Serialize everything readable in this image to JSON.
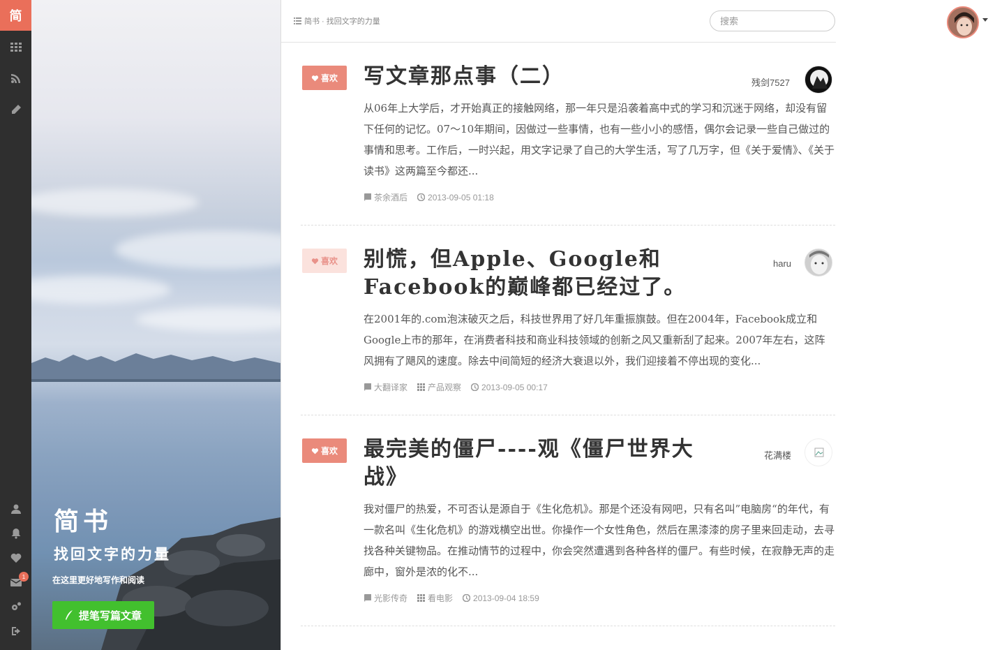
{
  "rail": {
    "logo": "简",
    "top_items": [
      "grid-icon",
      "rss-icon",
      "pencil-icon"
    ],
    "bottom_items": [
      "user-icon",
      "bell-icon",
      "heart-icon",
      "mail-icon",
      "settings-icon",
      "logout-icon"
    ],
    "mail_badge": "1"
  },
  "cover": {
    "title": "简书",
    "slogan": "找回文字的力量",
    "subtitle": "在这里更好地写作和阅读",
    "write_button": "提笔写篇文章"
  },
  "header": {
    "breadcrumb": "简书 · 找回文字的力量",
    "search_placeholder": "搜索"
  },
  "articles": [
    {
      "like_label": "喜欢",
      "title": "写文章那点事（二）",
      "author": "残剑7527",
      "body": "从06年上大学后，才开始真正的接触网络，那一年只是沿袭着高中式的学习和沉迷于网络，却没有留下任何的记忆。07～10年期间，因做过一些事情，也有一些小小的感悟，偶尔会记录一些自己做过的事情和思考。工作后，一时兴起，用文字记录了自己的大学生活，写了几万字，但《关于爱情》、《关于读书》这两篇至今都还...",
      "notebook": "茶余酒后",
      "collection": "",
      "time": "2013-09-05 01:18"
    },
    {
      "like_label": "喜欢",
      "title": "别慌，但Apple、Google和Facebook的巅峰都已经过了。",
      "author": "haru",
      "body": "在2001年的.com泡沫破灭之后，科技世界用了好几年重振旗鼓。但在2004年，Facebook成立和Google上市的那年，在消费者科技和商业科技领域的创新之风又重新刮了起来。2007年左右，这阵风拥有了飓风的速度。除去中间简短的经济大衰退以外，我们迎接着不停出现的变化...",
      "notebook": "大翻译家",
      "collection": "产品观察",
      "time": "2013-09-05 00:17"
    },
    {
      "like_label": "喜欢",
      "title": "最完美的僵尸----观《僵尸世界大战》",
      "author": "花满楼",
      "body": "我对僵尸的热爱，不可否认是源自于《生化危机》。那是个还没有网吧，只有名叫”电脑房“的年代，有一款名叫《生化危机》的游戏横空出世。你操作一个女性角色，然后在黑漆漆的房子里来回走动，去寻找各种关键物品。在推动情节的过程中，你会突然遭遇到各种各样的僵尸。有些时候，在寂静无声的走廊中，窗外是浓的化不...",
      "notebook": "光影传奇",
      "collection": "看电影",
      "time": "2013-09-04 18:59"
    }
  ],
  "colors": {
    "accent": "#ea6f5a",
    "like_active": "#ea8a7b",
    "write_button": "#42c02e",
    "rail": "#2f2f2f"
  }
}
